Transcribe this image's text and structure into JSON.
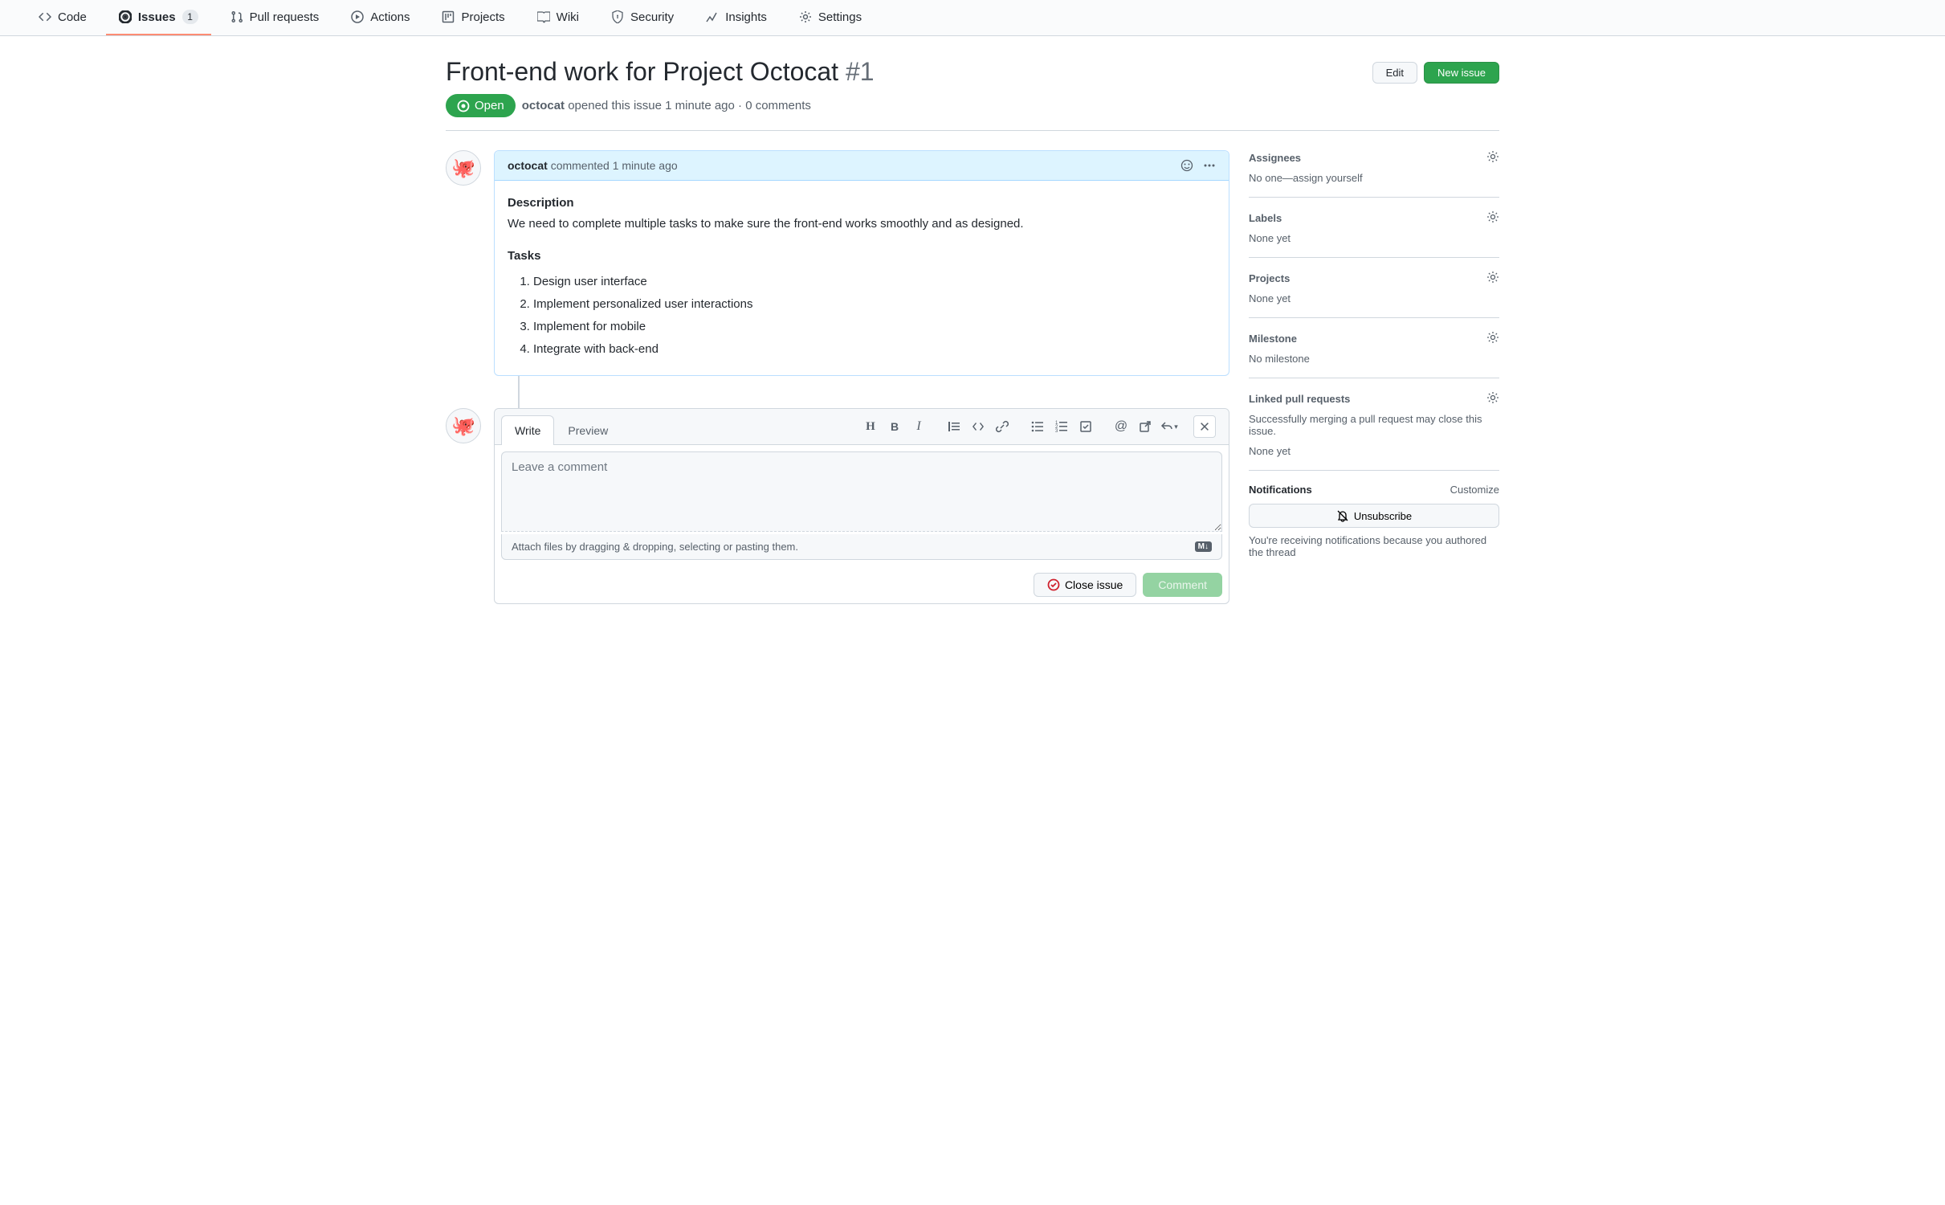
{
  "nav": {
    "code": "Code",
    "issues": "Issues",
    "issues_count": "1",
    "pull_requests": "Pull requests",
    "actions": "Actions",
    "projects": "Projects",
    "wiki": "Wiki",
    "security": "Security",
    "insights": "Insights",
    "settings": "Settings"
  },
  "issue": {
    "title": "Front-end work for Project Octocat",
    "number": "#1",
    "state": "Open",
    "author": "octocat",
    "opened_text": "opened this issue 1 minute ago · 0 comments",
    "edit_btn": "Edit",
    "new_issue_btn": "New issue"
  },
  "comment": {
    "author": "octocat",
    "meta": "commented 1 minute ago",
    "desc_heading": "Description",
    "desc_body": "We need to complete multiple tasks to make sure the front-end works smoothly and as designed.",
    "tasks_heading": "Tasks",
    "tasks": [
      "Design user interface",
      "Implement personalized user interactions",
      "Implement for mobile",
      "Integrate with back-end"
    ]
  },
  "compose": {
    "write_tab": "Write",
    "preview_tab": "Preview",
    "placeholder": "Leave a comment",
    "attach_hint": "Attach files by dragging & dropping, selecting or pasting them.",
    "close_btn": "Close issue",
    "comment_btn": "Comment"
  },
  "sidebar": {
    "assignees": {
      "title": "Assignees",
      "text": "No one—assign yourself"
    },
    "labels": {
      "title": "Labels",
      "text": "None yet"
    },
    "projects": {
      "title": "Projects",
      "text": "None yet"
    },
    "milestone": {
      "title": "Milestone",
      "text": "No milestone"
    },
    "linked_prs": {
      "title": "Linked pull requests",
      "desc": "Successfully merging a pull request may close this issue.",
      "text": "None yet"
    },
    "notifications": {
      "title": "Notifications",
      "customize": "Customize",
      "unsubscribe": "Unsubscribe",
      "reason": "You're receiving notifications because you authored the thread"
    }
  }
}
